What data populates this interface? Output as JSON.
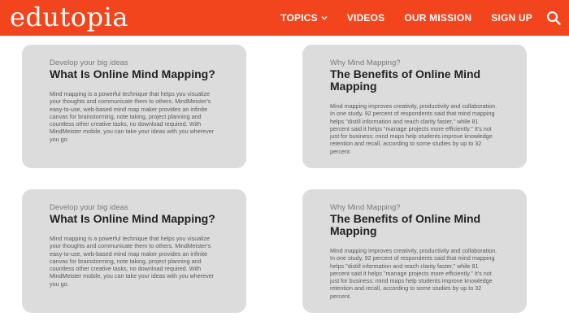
{
  "header": {
    "logo": "edutopia",
    "nav": [
      {
        "label": "TOPICS"
      },
      {
        "label": "VIDEOS"
      },
      {
        "label": "OUR MISSION"
      },
      {
        "label": "SIGN UP"
      }
    ]
  },
  "colors": {
    "brand": "#f2451d",
    "card_bg": "#dcdcdc"
  },
  "cards": [
    {
      "kicker": "Develop your big ideas",
      "title": "What Is Online Mind Mapping?",
      "body": "Mind mapping is a powerful technique that helps you visualize your thoughts and communicate them to others. MindMeister's easy-to-use, web-based mind map maker provides an infinite canvas for brainstorming, note taking, project planning and countless other creative tasks, no download required. With MindMeister mobile, you can take your ideas with you wherever you go."
    },
    {
      "kicker": "Why Mind Mapping?",
      "title": "The Benefits of Online Mind Mapping",
      "body": "Mind mapping improves creativity, productivity and collaboration. In one study, 92 percent of respondents said that mind mapping helps \"distill information and reach clarity faster,\" while 81 percent said it helps \"manage projects more efficiently.\" It's not just for business: mind maps help students improve knowledge retention and recall, according to some studies by up to 32 percent."
    },
    {
      "kicker": "Develop your big ideas",
      "title": "What Is Online Mind Mapping?",
      "body": "Mind mapping is a powerful technique that helps you visualize your thoughts and communicate them to others. MindMeister's easy-to-use, web-based mind map maker provides an infinite canvas for brainstorming, note taking, project planning and countless other creative tasks, no download required. With MindMeister mobile, you can take your ideas with you wherever you go."
    },
    {
      "kicker": "Why Mind Mapping?",
      "title": "The Benefits of Online Mind Mapping",
      "body": "Mind mapping improves creativity, productivity and collaboration. In one study, 92 percent of respondents said that mind mapping helps \"distill information and reach clarity faster,\" while 81 percent said it helps \"manage projects more efficiently.\" It's not just for business: mind maps help students improve knowledge retention and recall, according to some studies by up to 32 percent."
    }
  ]
}
